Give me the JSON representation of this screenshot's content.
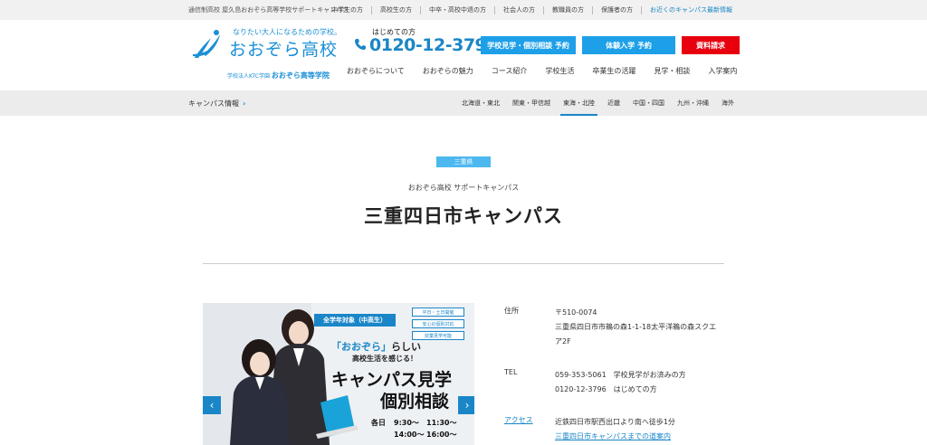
{
  "topbar": {
    "school": "通信制高校 屋久島おおぞら高等学校サポートキャンパス",
    "links": [
      "中学生の方",
      "高校生の方",
      "中卒・高校中退の方",
      "社会人の方",
      "教職員の方",
      "保護者の方",
      "お近くのキャンパス最新情報"
    ]
  },
  "logo": {
    "tagline": "なりたい大人になるための学校。",
    "name": "おおぞら高校",
    "corp_prefix": "学校法人KTC学園 ",
    "corp_name": "おおぞら高等学院"
  },
  "phone": {
    "label": "はじめての方",
    "number": "0120-12-3796"
  },
  "cta": {
    "visit": "学校見学・個別相談 予約",
    "trial": "体験入学 予約",
    "request": "資料請求"
  },
  "mainnav": [
    "おおぞらについて",
    "おおぞらの魅力",
    "コース紹介",
    "学校生活",
    "卒業生の活躍",
    "見学・相談",
    "入学案内"
  ],
  "campusbar": {
    "title": "キャンパス情報",
    "arrow": "›",
    "regions": [
      "北海道・東北",
      "関東・甲信越",
      "東海・北陸",
      "近畿",
      "中国・四国",
      "九州・沖縄",
      "海外"
    ],
    "active_region": "東海・北陸"
  },
  "heading": {
    "badge": "三重県",
    "subtitle": "おおぞら高校 サポートキャンパス",
    "title": "三重四日市キャンパス"
  },
  "slide": {
    "pill": "全学年対象（中高生）",
    "tags": [
      "平日・土日開催",
      "安心の個別対応",
      "授業見学可能"
    ],
    "line1_quote": "「おおぞら」",
    "line1_rest": "らしい",
    "line2": "高校生活を感じる！",
    "big1": "キャンパス見学",
    "big2": "個別相談",
    "day": "各日",
    "times": [
      "9:30〜",
      "11:30〜",
      "14:00〜",
      "16:00〜"
    ],
    "prev": "‹",
    "next": "›"
  },
  "info": {
    "address_label": "住所",
    "address": [
      "〒510-0074",
      "三重県四日市市鵜の森1-1-18太平洋鵜の森スクエ",
      "ア2F"
    ],
    "tel_label": "TEL",
    "tel": [
      "059-353-5061　学校見学がお済みの方",
      "0120-12-3796　はじめての方"
    ],
    "access_label": "アクセス",
    "access": "近鉄四日市駅西出口より南へ徒歩1分",
    "access_link": "三重四日市キャンパスまでの道案内"
  },
  "colors": {
    "brand": "#1a86c8",
    "cta_blue": "#1da0e8",
    "cta_red": "#e8000f",
    "badge": "#4db8ef"
  }
}
